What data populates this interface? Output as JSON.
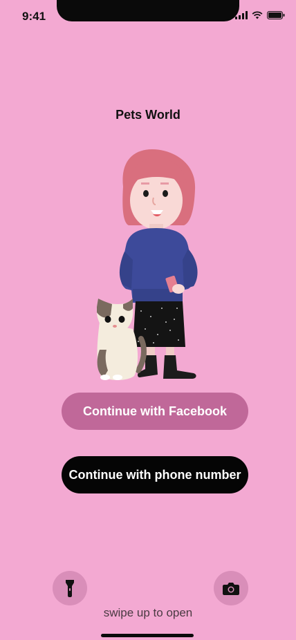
{
  "status_bar": {
    "time": "9:41"
  },
  "app": {
    "title": "Pets World"
  },
  "buttons": {
    "facebook": "Continue with Facebook",
    "phone": "Continue with phone number"
  },
  "lock_screen": {
    "swipe_hint": "swipe up to open"
  },
  "icons": {
    "flashlight": "flashlight-icon",
    "camera": "camera-icon"
  },
  "colors": {
    "background": "#f3a9d2",
    "facebook_button": "#c06899",
    "phone_button": "#050505"
  }
}
